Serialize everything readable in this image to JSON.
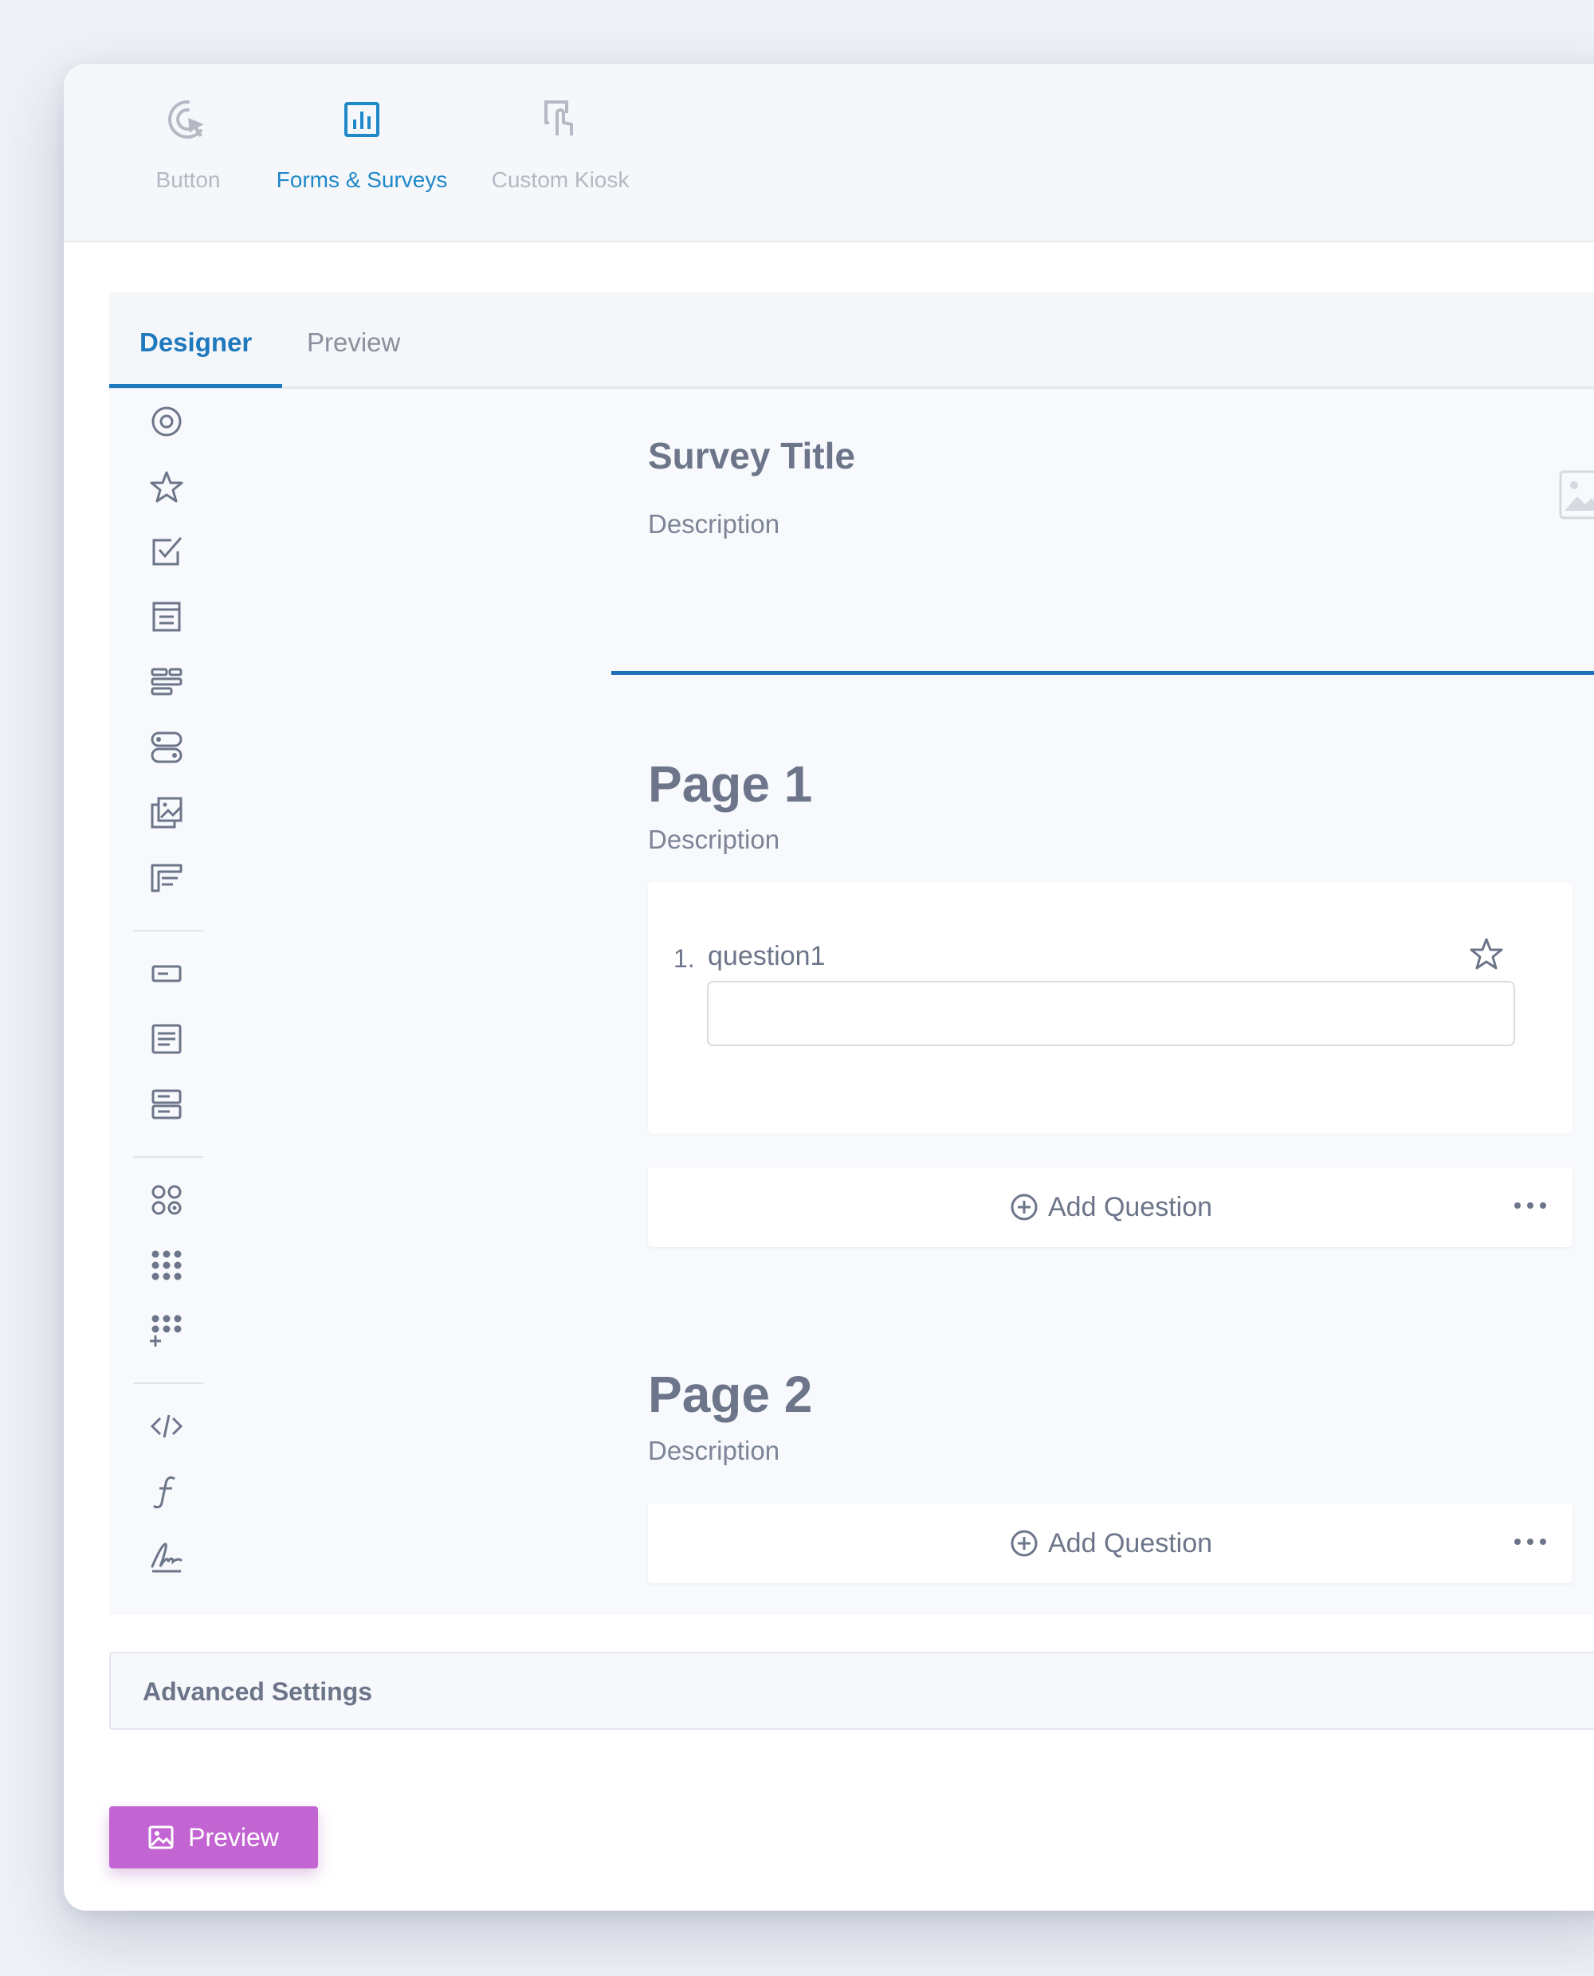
{
  "colors": {
    "accent_blue": "#1e79bd",
    "preview_purple": "#c264d2",
    "muted_text": "#b4b9c4",
    "body_text": "#6c7589"
  },
  "top_tabs": [
    {
      "label": "Button",
      "icon": "cursor-click-icon",
      "active": false
    },
    {
      "label": "Forms & Surveys",
      "icon": "bar-chart-icon",
      "active": true
    },
    {
      "label": "Custom Kiosk",
      "icon": "kiosk-touch-icon",
      "active": false
    }
  ],
  "tabs": [
    {
      "label": "Designer",
      "active": true
    },
    {
      "label": "Preview",
      "active": false
    }
  ],
  "toolbox_icons": [
    "radiogroup-icon",
    "rating-star-icon",
    "checkbox-icon",
    "dropdown-icon",
    "ranking-icon",
    "boolean-toggle-icon",
    "image-picker-icon",
    "matrix-icon",
    "single-input-icon",
    "comment-icon",
    "multiple-text-icon",
    "panel-icon",
    "dynamic-panel-icon",
    "dynamic-matrix-icon",
    "html-icon",
    "expression-icon",
    "signature-icon"
  ],
  "survey": {
    "title": "Survey Title",
    "description": "Description",
    "logo_icon": "image-placeholder-icon"
  },
  "pages": [
    {
      "title": "Page 1",
      "description": "Description",
      "questions": [
        {
          "number": "1.",
          "title": "question1",
          "value": ""
        }
      ],
      "add_question_label": "Add Question"
    },
    {
      "title": "Page 2",
      "description": "Description",
      "questions": [],
      "add_question_label": "Add Question"
    }
  ],
  "advanced_settings_label": "Advanced Settings",
  "preview_button_label": "Preview"
}
